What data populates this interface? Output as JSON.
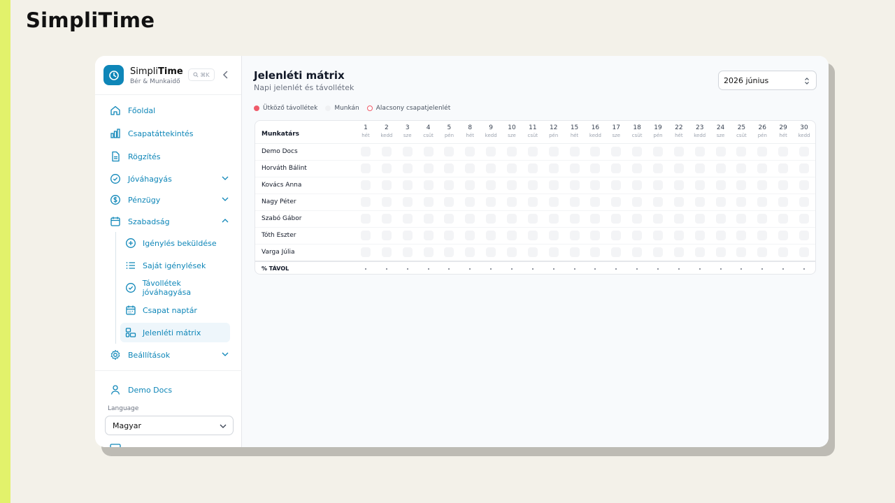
{
  "brand_heading": "SimpliTime",
  "app": {
    "name_part1": "Simpli",
    "name_part2": "Time",
    "subtitle": "Bér & Munkaidő",
    "shortcut": "⌘K"
  },
  "nav": {
    "items": [
      {
        "label": "Főoldal",
        "icon": "home-icon"
      },
      {
        "label": "Csapatáttekintés",
        "icon": "bar-chart-icon"
      },
      {
        "label": "Rögzítés",
        "icon": "document-icon"
      },
      {
        "label": "Jóváhagyás",
        "icon": "check-circle-icon"
      },
      {
        "label": "Pénzügy",
        "icon": "dollar-icon"
      },
      {
        "label": "Szabadság",
        "icon": "calendar-icon"
      }
    ],
    "sub_items": [
      {
        "label": "Igénylés beküldése",
        "icon": "plus-circle-icon"
      },
      {
        "label": "Saját igénylések",
        "icon": "list-icon"
      },
      {
        "label": "Távollétek jóváhagyása",
        "icon": "check-circle-icon"
      },
      {
        "label": "Csapat naptár",
        "icon": "calendar-grid-icon"
      },
      {
        "label": "Jelenléti mátrix",
        "icon": "matrix-icon"
      }
    ],
    "settings": {
      "label": "Beállítások",
      "icon": "gear-icon"
    },
    "user": {
      "label": "Demo Docs",
      "icon": "user-icon"
    },
    "language_label": "Language",
    "language_value": "Magyar"
  },
  "main": {
    "title": "Jelenléti mátrix",
    "subtitle": "Napi jelenlét és távollétek",
    "month": "2026 június",
    "legend": [
      {
        "label": "Ütköző távollétek",
        "color": "#ef5b6a"
      },
      {
        "label": "Munkán",
        "color": "#f3f4f6"
      },
      {
        "label": "Alacsony csapatjelenlét",
        "color": "#ef5b6a"
      }
    ],
    "table": {
      "name_header": "Munkatárs",
      "footer_label": "% TÁVOL",
      "footer_value": "·",
      "days": [
        {
          "num": "1",
          "wd": "hét"
        },
        {
          "num": "2",
          "wd": "kedd"
        },
        {
          "num": "3",
          "wd": "sze"
        },
        {
          "num": "4",
          "wd": "csüt"
        },
        {
          "num": "5",
          "wd": "pén"
        },
        {
          "num": "8",
          "wd": "hét"
        },
        {
          "num": "9",
          "wd": "kedd"
        },
        {
          "num": "10",
          "wd": "sze"
        },
        {
          "num": "11",
          "wd": "csüt"
        },
        {
          "num": "12",
          "wd": "pén"
        },
        {
          "num": "15",
          "wd": "hét"
        },
        {
          "num": "16",
          "wd": "kedd"
        },
        {
          "num": "17",
          "wd": "sze"
        },
        {
          "num": "18",
          "wd": "csüt"
        },
        {
          "num": "19",
          "wd": "pén"
        },
        {
          "num": "22",
          "wd": "hét"
        },
        {
          "num": "23",
          "wd": "kedd"
        },
        {
          "num": "24",
          "wd": "sze"
        },
        {
          "num": "25",
          "wd": "csüt"
        },
        {
          "num": "26",
          "wd": "pén"
        },
        {
          "num": "29",
          "wd": "hét"
        },
        {
          "num": "30",
          "wd": "kedd"
        }
      ],
      "rows": [
        "Demo Docs",
        "Horváth Bálint",
        "Kovács Anna",
        "Nagy Péter",
        "Szabó Gábor",
        "Tóth Eszter",
        "Varga Júlia"
      ]
    }
  }
}
